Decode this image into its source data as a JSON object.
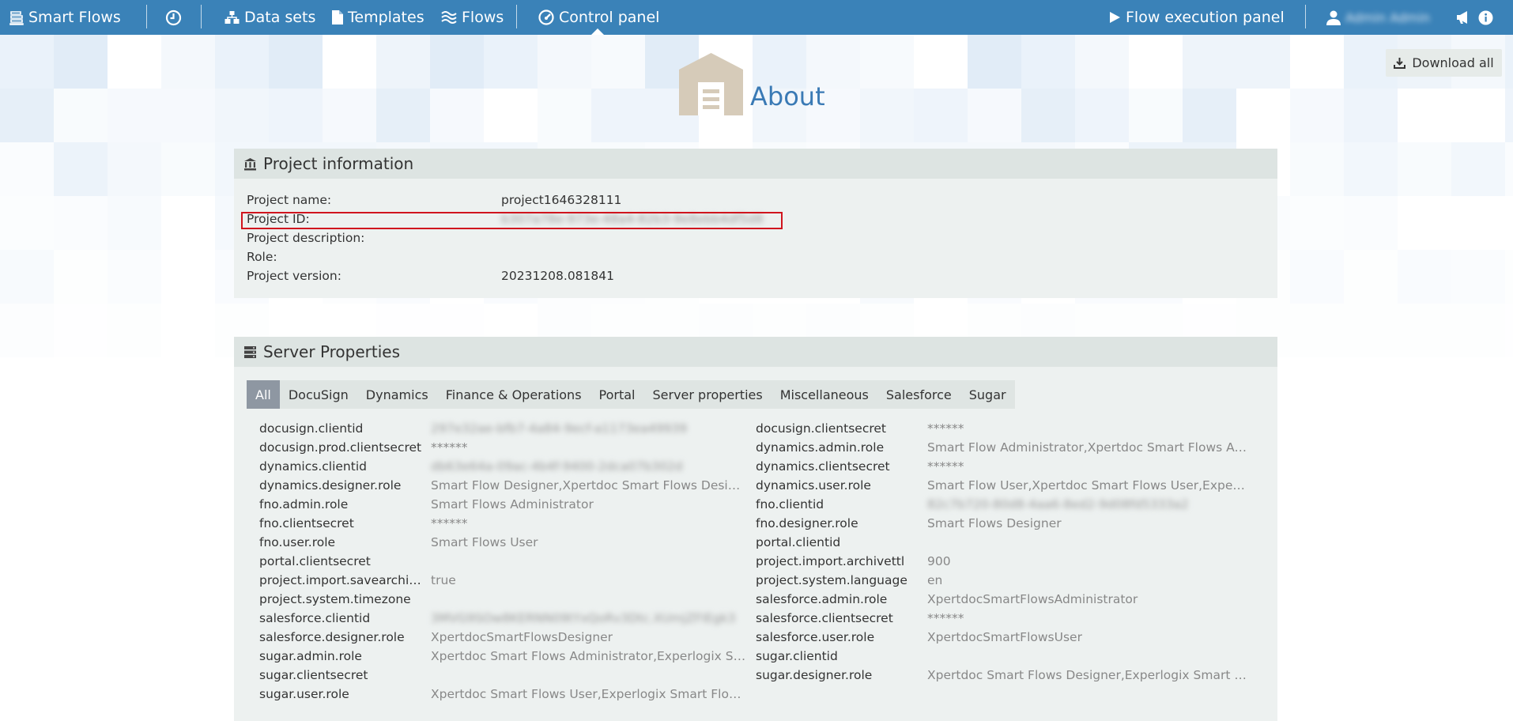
{
  "nav": {
    "brand": "Smart Flows",
    "data_sets": "Data sets",
    "templates": "Templates",
    "flows": "Flows",
    "control_panel": "Control panel",
    "flow_execution_panel": "Flow execution panel",
    "user_name": "Admin Admin"
  },
  "about": {
    "title": "About",
    "download_all": "Download all"
  },
  "project_info": {
    "heading": "Project information",
    "rows": [
      {
        "label": "Project name:",
        "value": "project1646328111"
      },
      {
        "label": "Project ID:",
        "value": "b307a78e-973e-48a4-82b3-9e8ebb4df5d8"
      },
      {
        "label": "Project description:",
        "value": ""
      },
      {
        "label": "Role:",
        "value": ""
      },
      {
        "label": "Project version:",
        "value": "20231208.081841"
      }
    ]
  },
  "server_props": {
    "heading": "Server Properties",
    "tabs": [
      "All",
      "DocuSign",
      "Dynamics",
      "Finance & Operations",
      "Portal",
      "Server properties",
      "Miscellaneous",
      "Salesforce",
      "Sugar"
    ],
    "active_tab": "All",
    "left": [
      {
        "key": "docusign.clientid",
        "value": "297e32ae-bfb7-4a84-9ecf-a1173ea49939"
      },
      {
        "key": "docusign.prod.clientsecret",
        "value": "******"
      },
      {
        "key": "dynamics.clientid",
        "value": "db63e64a-09ac-4b4f-9400-2dca07b302d"
      },
      {
        "key": "dynamics.designer.role",
        "value": "Smart Flow Designer,Xpertdoc Smart Flows Design…"
      },
      {
        "key": "fno.admin.role",
        "value": "Smart Flows Administrator"
      },
      {
        "key": "fno.clientsecret",
        "value": "******"
      },
      {
        "key": "fno.user.role",
        "value": "Smart Flows User"
      },
      {
        "key": "portal.clientsecret",
        "value": ""
      },
      {
        "key": "project.import.savearchi…",
        "value": "true"
      },
      {
        "key": "project.system.timezone",
        "value": ""
      },
      {
        "key": "salesforce.clientid",
        "value": "3MVG9SOw8KERNN09tYxQoRv3Dtc.XUmjZFIEgk3"
      },
      {
        "key": "salesforce.designer.role",
        "value": "XpertdocSmartFlowsDesigner"
      },
      {
        "key": "sugar.admin.role",
        "value": "Xpertdoc Smart Flows Administrator,Experlogix Sm…"
      },
      {
        "key": "sugar.clientsecret",
        "value": ""
      },
      {
        "key": "sugar.user.role",
        "value": "Xpertdoc Smart Flows User,Experlogix Smart Flows…"
      }
    ],
    "right": [
      {
        "key": "docusign.clientsecret",
        "value": "******"
      },
      {
        "key": "dynamics.admin.role",
        "value": "Smart Flow Administrator,Xpertdoc Smart Flows Ad…"
      },
      {
        "key": "dynamics.clientsecret",
        "value": "******"
      },
      {
        "key": "dynamics.user.role",
        "value": "Smart Flow User,Xpertdoc Smart Flows User,Experl…"
      },
      {
        "key": "fno.clientid",
        "value": "82c7b720-80d8-4aa6-8ed2-9d08fd5333a2"
      },
      {
        "key": "fno.designer.role",
        "value": "Smart Flows Designer"
      },
      {
        "key": "portal.clientid",
        "value": ""
      },
      {
        "key": "project.import.archivettl",
        "value": "900"
      },
      {
        "key": "project.system.language",
        "value": "en"
      },
      {
        "key": "salesforce.admin.role",
        "value": "XpertdocSmartFlowsAdministrator"
      },
      {
        "key": "salesforce.clientsecret",
        "value": "******"
      },
      {
        "key": "salesforce.user.role",
        "value": "XpertdocSmartFlowsUser"
      },
      {
        "key": "sugar.clientid",
        "value": ""
      },
      {
        "key": "sugar.designer.role",
        "value": "Xpertdoc Smart Flows Designer,Experlogix Smart F…"
      }
    ]
  }
}
